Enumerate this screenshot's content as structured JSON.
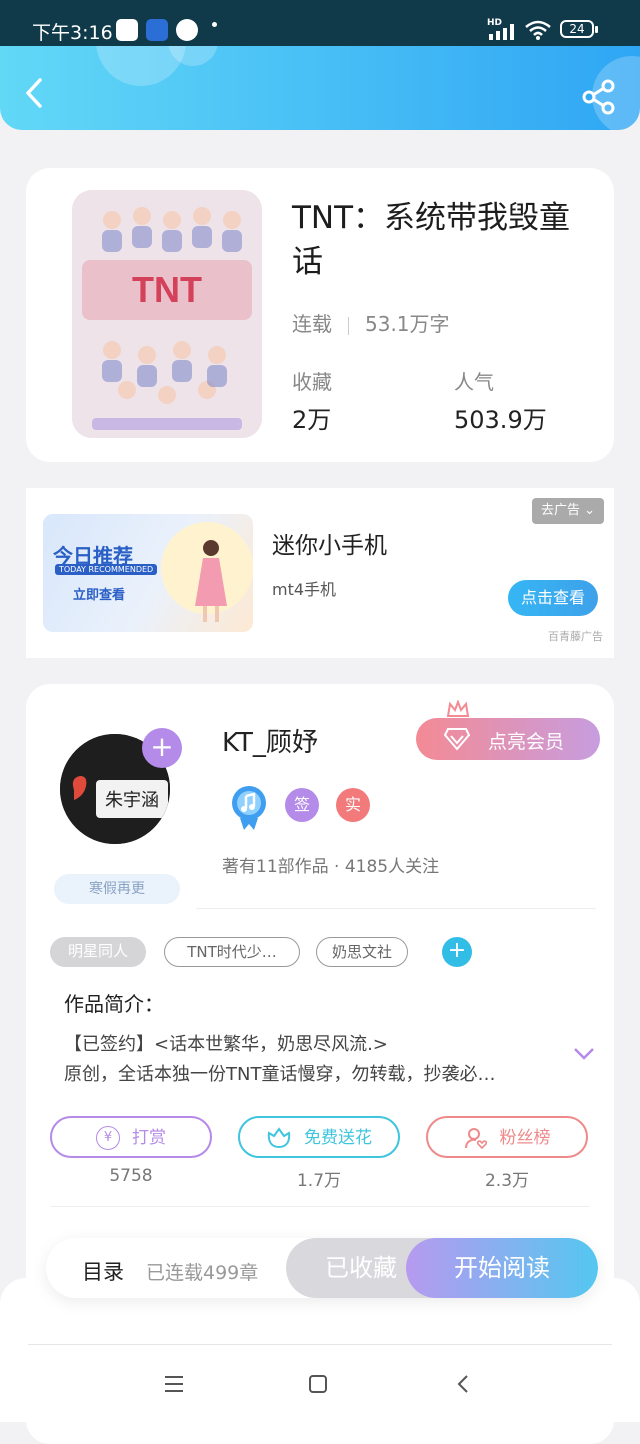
{
  "status_bar": {
    "time": "下午3:16",
    "network": "HD",
    "battery": "24"
  },
  "book": {
    "title": "TNT：系统带我毁童话",
    "status": "连载",
    "word_count": "53.1万字",
    "favorites_label": "收藏",
    "favorites_value": "2万",
    "popularity_label": "人气",
    "popularity_value": "503.9万"
  },
  "ad": {
    "image_title": "今日推荐",
    "image_subtitle": "TODAY RECOMMENDED",
    "image_cta": "立即查看",
    "title": "迷你小手机",
    "subtitle": "mt4手机",
    "close_label": "去广告",
    "button": "点击查看",
    "source": "百青藤广告"
  },
  "author": {
    "avatar_text": "朱宇涵",
    "name": "KT_顾妤",
    "vip_button": "点亮会员",
    "badge_sign": "签",
    "badge_real": "实",
    "stats": "著有11部作品 · 4185人关注",
    "status_tag": "寒假再更"
  },
  "tags": [
    "明星同人",
    "TNT时代少…",
    "奶思文社"
  ],
  "intro": {
    "title": "作品简介：",
    "line1": "【已签约】<话本世繁华，奶思尽风流.>",
    "line2": "原创，全话本独一份TNT童话慢穿，勿转载，抄袭必…"
  },
  "actions": [
    {
      "label": "打赏",
      "count": "5758",
      "color": "#b58ae8"
    },
    {
      "label": "免费送花",
      "count": "1.7万",
      "color": "#3fc5dd"
    },
    {
      "label": "粉丝榜",
      "count": "2.3万",
      "color": "#ee8a8a"
    }
  ],
  "bottom_bar": {
    "toc": "目录",
    "chapters": "已连载499章",
    "collected": "已收藏",
    "start": "开始阅读"
  },
  "colors": {
    "header_start": "#62d8f7",
    "header_end": "#2fa6f4",
    "accent_purple": "#b48be8",
    "accent_cyan": "#3fc5dd"
  }
}
